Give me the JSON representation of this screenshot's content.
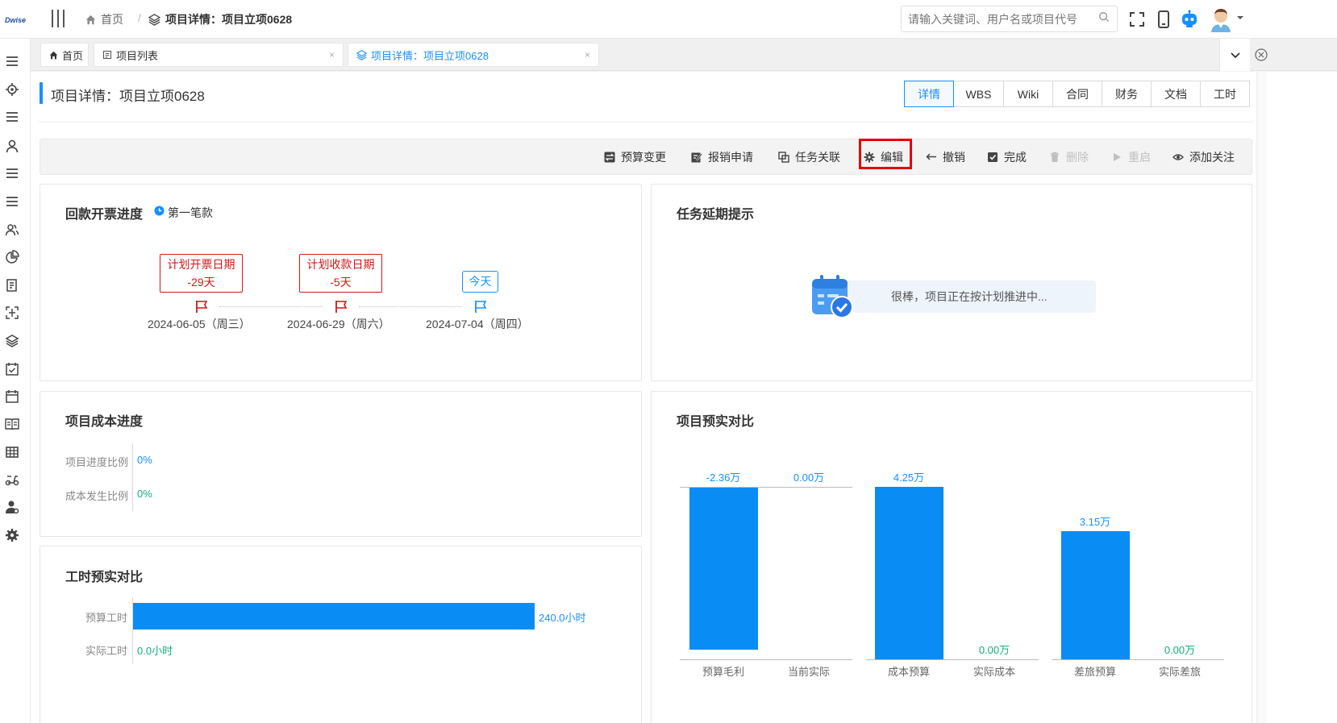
{
  "header": {
    "logo_text": "Dwise",
    "breadcrumb_home": "首页",
    "breadcrumb_current": "项目详情：项目立项0628",
    "search_placeholder": "请输入关键词、用户名或项目代号"
  },
  "tabs": [
    {
      "label": "首页"
    },
    {
      "label": "项目列表",
      "close": "×"
    },
    {
      "label": "项目详情：项目立项0628",
      "close": "×"
    }
  ],
  "page": {
    "title": "项目详情：项目立项0628",
    "tabs": [
      "详情",
      "WBS",
      "Wiki",
      "合同",
      "财务",
      "文档",
      "工时"
    ],
    "active_tab": "详情"
  },
  "toolbar": {
    "budget_change": "预算变更",
    "reimburse": "报销申请",
    "task_link": "任务关联",
    "edit": "编辑",
    "revoke": "撤销",
    "complete": "完成",
    "delete": "删除",
    "restart": "重启",
    "follow": "添加关注"
  },
  "payment": {
    "title": "回款开票进度",
    "tag": "第一笔款",
    "milestones": [
      {
        "label": "计划开票日期",
        "offset": "-29天",
        "date": "2024-06-05（周三）"
      },
      {
        "label": "计划收款日期",
        "offset": "-5天",
        "date": "2024-06-29（周六）"
      },
      {
        "label": "今天",
        "date": "2024-07-04（周四）"
      }
    ]
  },
  "delay": {
    "title": "任务延期提示",
    "message": "很棒，项目正在按计划推进中..."
  },
  "cost": {
    "title": "项目成本进度",
    "progress_label": "项目进度比例",
    "progress_value": "0%",
    "cost_label": "成本发生比例",
    "cost_value": "0%"
  },
  "hours": {
    "title": "工时预实对比",
    "chart_data": {
      "type": "bar",
      "orientation": "horizontal",
      "categories": [
        "预算工时",
        "实际工时"
      ],
      "values": [
        240.0,
        0.0
      ],
      "value_labels": [
        "240.0小时",
        "0.0小时"
      ],
      "unit": "小时"
    }
  },
  "budget": {
    "title": "项目预实对比",
    "chart_data": {
      "type": "bar",
      "categories": [
        "预算毛利",
        "当前实际",
        "成本预算",
        "实际成本",
        "差旅预算",
        "实际差旅"
      ],
      "values": [
        -2.36,
        0.0,
        4.25,
        0.0,
        3.15,
        0.0
      ],
      "value_labels": [
        "-2.36万",
        "0.00万",
        "4.25万",
        "0.00万",
        "3.15万",
        "0.00万"
      ],
      "unit": "万",
      "color": "#0a8cf5"
    }
  },
  "colors": {
    "accent": "#1890ff",
    "danger": "#d41717",
    "success": "#13b07a"
  }
}
